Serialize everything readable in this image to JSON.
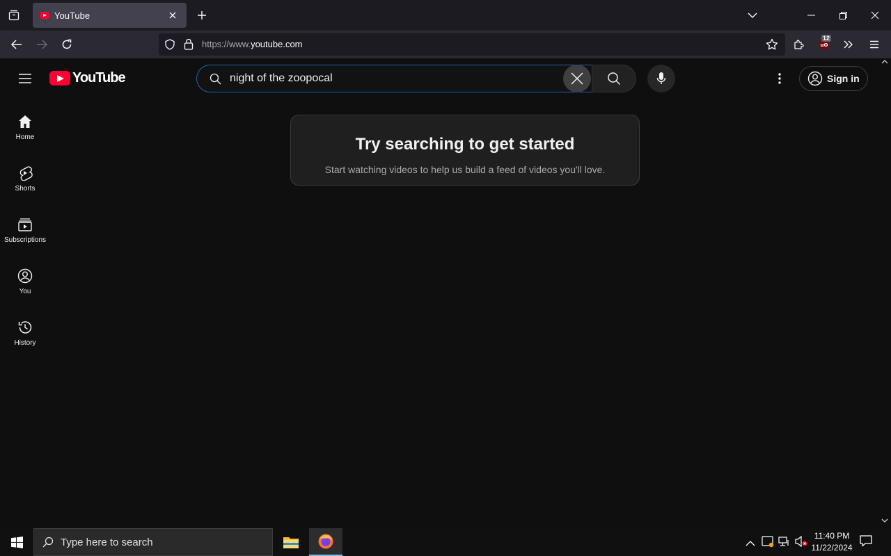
{
  "browser": {
    "tab_title": "YouTube",
    "url_prefix": "https://www.",
    "url_domain": "youtube.com",
    "extension_badge": "12"
  },
  "youtube": {
    "logo_text": "YouTube",
    "search_value": "night of the zoopocal",
    "sign_in_label": "Sign in",
    "guide": [
      {
        "label": "Home",
        "icon": "home-icon"
      },
      {
        "label": "Shorts",
        "icon": "shorts-icon"
      },
      {
        "label": "Subscriptions",
        "icon": "subscriptions-icon"
      },
      {
        "label": "You",
        "icon": "you-icon"
      },
      {
        "label": "History",
        "icon": "history-icon"
      }
    ],
    "empty_state": {
      "title": "Try searching to get started",
      "subtitle": "Start watching videos to help us build a feed of videos you'll love."
    },
    "colors": {
      "brand_red": "#ff0033",
      "background": "#0f0f0f",
      "focus_blue": "#1c62b9"
    }
  },
  "taskbar": {
    "search_placeholder": "Type here to search",
    "time": "11:40 PM",
    "date": "11/22/2024"
  }
}
